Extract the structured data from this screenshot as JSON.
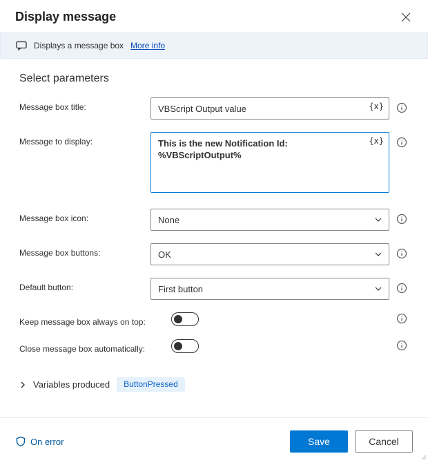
{
  "header": {
    "title": "Display message"
  },
  "infoBar": {
    "text": "Displays a message box",
    "link": "More info"
  },
  "tokens": {
    "var": "{x}"
  },
  "body": {
    "sectionTitle": "Select parameters",
    "fields": {
      "title": {
        "label": "Message box title:",
        "value": "VBScript Output value"
      },
      "message": {
        "label": "Message to display:",
        "value": "This is the new Notification Id: %VBScriptOutput%"
      },
      "icon": {
        "label": "Message box icon:",
        "value": "None"
      },
      "buttons": {
        "label": "Message box buttons:",
        "value": "OK"
      },
      "defaultButton": {
        "label": "Default button:",
        "value": "First button"
      },
      "alwaysOnTop": {
        "label": "Keep message box always on top:",
        "value": false
      },
      "closeAuto": {
        "label": "Close message box automatically:",
        "value": false
      }
    },
    "variables": {
      "label": "Variables produced",
      "items": [
        "ButtonPressed"
      ]
    }
  },
  "footer": {
    "onError": "On error",
    "save": "Save",
    "cancel": "Cancel"
  }
}
